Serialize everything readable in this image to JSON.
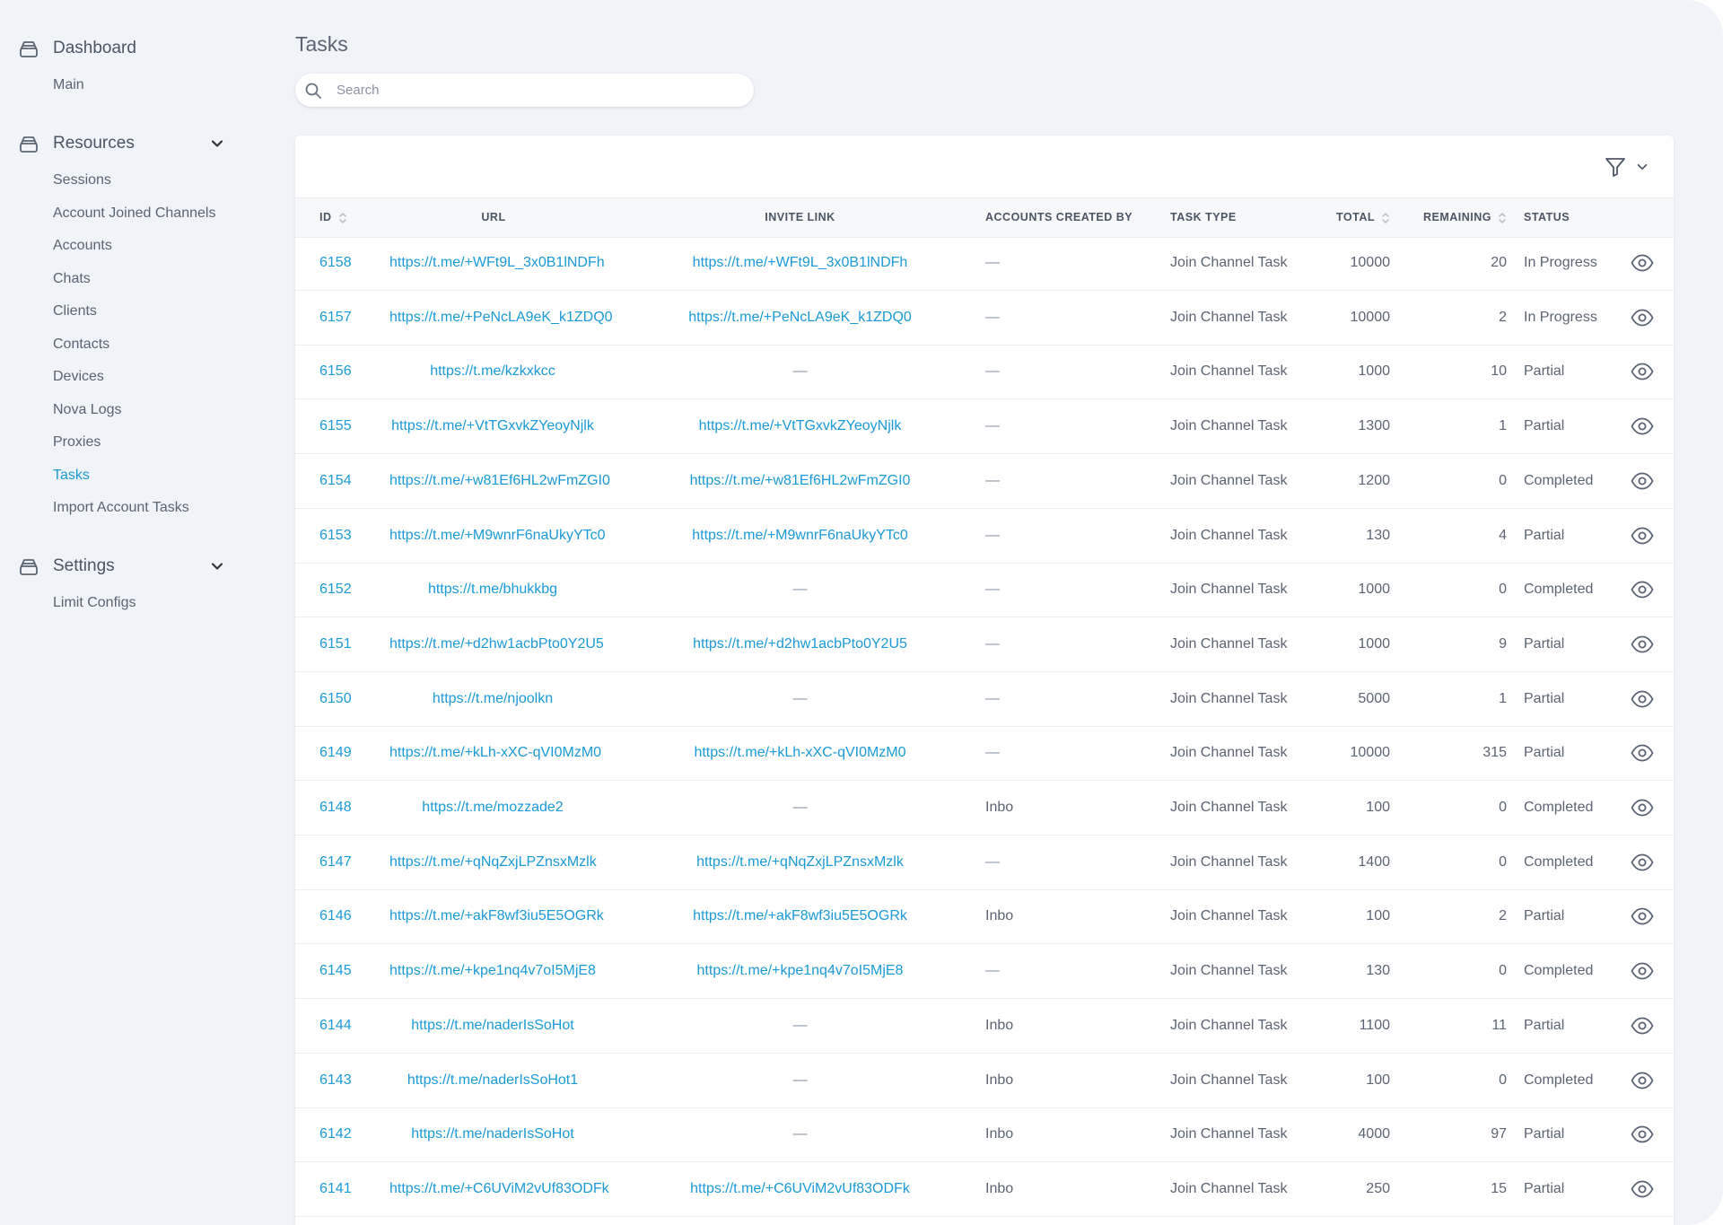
{
  "sidebar": {
    "dashboard": {
      "label": "Dashboard",
      "items": [
        "Main"
      ]
    },
    "resources": {
      "label": "Resources",
      "items": [
        "Sessions",
        "Account Joined Channels",
        "Accounts",
        "Chats",
        "Clients",
        "Contacts",
        "Devices",
        "Nova Logs",
        "Proxies",
        "Tasks",
        "Import Account Tasks"
      ],
      "active": "Tasks"
    },
    "settings": {
      "label": "Settings",
      "items": [
        "Limit Configs"
      ]
    }
  },
  "page": {
    "title": "Tasks"
  },
  "search": {
    "placeholder": "Search",
    "value": ""
  },
  "table": {
    "headers": {
      "id": "ID",
      "url": "URL",
      "invite": "INVITE LINK",
      "accounts": "ACCOUNTS CREATED BY",
      "type": "TASK TYPE",
      "total": "TOTAL",
      "remaining": "REMAINING",
      "status": "STATUS"
    },
    "rows": [
      {
        "id": "6158",
        "url": "https://t.me/+WFt9L_3x0B1lNDFh",
        "invite": "https://t.me/+WFt9L_3x0B1lNDFh",
        "accounts": "—",
        "type": "Join Channel Task",
        "total": "10000",
        "remaining": "20",
        "status": "In Progress"
      },
      {
        "id": "6157",
        "url": "https://t.me/+PeNcLA9eK_k1ZDQ0",
        "invite": "https://t.me/+PeNcLA9eK_k1ZDQ0",
        "accounts": "—",
        "type": "Join Channel Task",
        "total": "10000",
        "remaining": "2",
        "status": "In Progress"
      },
      {
        "id": "6156",
        "url": "https://t.me/kzkxkcc",
        "invite": "—",
        "accounts": "—",
        "type": "Join Channel Task",
        "total": "1000",
        "remaining": "10",
        "status": "Partial"
      },
      {
        "id": "6155",
        "url": "https://t.me/+VtTGxvkZYeoyNjlk",
        "invite": "https://t.me/+VtTGxvkZYeoyNjlk",
        "accounts": "—",
        "type": "Join Channel Task",
        "total": "1300",
        "remaining": "1",
        "status": "Partial"
      },
      {
        "id": "6154",
        "url": "https://t.me/+w81Ef6HL2wFmZGI0",
        "invite": "https://t.me/+w81Ef6HL2wFmZGI0",
        "accounts": "—",
        "type": "Join Channel Task",
        "total": "1200",
        "remaining": "0",
        "status": "Completed"
      },
      {
        "id": "6153",
        "url": "https://t.me/+M9wnrF6naUkyYTc0",
        "invite": "https://t.me/+M9wnrF6naUkyYTc0",
        "accounts": "—",
        "type": "Join Channel Task",
        "total": "130",
        "remaining": "4",
        "status": "Partial"
      },
      {
        "id": "6152",
        "url": "https://t.me/bhukkbg",
        "invite": "—",
        "accounts": "—",
        "type": "Join Channel Task",
        "total": "1000",
        "remaining": "0",
        "status": "Completed"
      },
      {
        "id": "6151",
        "url": "https://t.me/+d2hw1acbPto0Y2U5",
        "invite": "https://t.me/+d2hw1acbPto0Y2U5",
        "accounts": "—",
        "type": "Join Channel Task",
        "total": "1000",
        "remaining": "9",
        "status": "Partial"
      },
      {
        "id": "6150",
        "url": "https://t.me/njoolkn",
        "invite": "—",
        "accounts": "—",
        "type": "Join Channel Task",
        "total": "5000",
        "remaining": "1",
        "status": "Partial"
      },
      {
        "id": "6149",
        "url": "https://t.me/+kLh-xXC-qVI0MzM0",
        "invite": "https://t.me/+kLh-xXC-qVI0MzM0",
        "accounts": "—",
        "type": "Join Channel Task",
        "total": "10000",
        "remaining": "315",
        "status": "Partial"
      },
      {
        "id": "6148",
        "url": "https://t.me/mozzade2",
        "invite": "—",
        "accounts": "Inbo",
        "type": "Join Channel Task",
        "total": "100",
        "remaining": "0",
        "status": "Completed"
      },
      {
        "id": "6147",
        "url": "https://t.me/+qNqZxjLPZnsxMzlk",
        "invite": "https://t.me/+qNqZxjLPZnsxMzlk",
        "accounts": "—",
        "type": "Join Channel Task",
        "total": "1400",
        "remaining": "0",
        "status": "Completed"
      },
      {
        "id": "6146",
        "url": "https://t.me/+akF8wf3iu5E5OGRk",
        "invite": "https://t.me/+akF8wf3iu5E5OGRk",
        "accounts": "Inbo",
        "type": "Join Channel Task",
        "total": "100",
        "remaining": "2",
        "status": "Partial"
      },
      {
        "id": "6145",
        "url": "https://t.me/+kpe1nq4v7oI5MjE8",
        "invite": "https://t.me/+kpe1nq4v7oI5MjE8",
        "accounts": "—",
        "type": "Join Channel Task",
        "total": "130",
        "remaining": "0",
        "status": "Completed"
      },
      {
        "id": "6144",
        "url": "https://t.me/naderIsSoHot",
        "invite": "—",
        "accounts": "Inbo",
        "type": "Join Channel Task",
        "total": "1100",
        "remaining": "11",
        "status": "Partial"
      },
      {
        "id": "6143",
        "url": "https://t.me/naderIsSoHot1",
        "invite": "—",
        "accounts": "Inbo",
        "type": "Join Channel Task",
        "total": "100",
        "remaining": "0",
        "status": "Completed"
      },
      {
        "id": "6142",
        "url": "https://t.me/naderIsSoHot",
        "invite": "—",
        "accounts": "Inbo",
        "type": "Join Channel Task",
        "total": "4000",
        "remaining": "97",
        "status": "Partial"
      },
      {
        "id": "6141",
        "url": "https://t.me/+C6UViM2vUf83ODFk",
        "invite": "https://t.me/+C6UViM2vUf83ODFk",
        "accounts": "Inbo",
        "type": "Join Channel Task",
        "total": "250",
        "remaining": "15",
        "status": "Partial"
      }
    ]
  },
  "icons": {
    "group": "stack-icon",
    "chevron": "chevron-down-icon",
    "search": "search-icon",
    "filter": "filter-icon",
    "sort": "sort-icon",
    "view": "eye-icon"
  },
  "colors": {
    "accent": "#1a9ad6",
    "background": "#f0f3f8",
    "text": "#4b5563"
  }
}
